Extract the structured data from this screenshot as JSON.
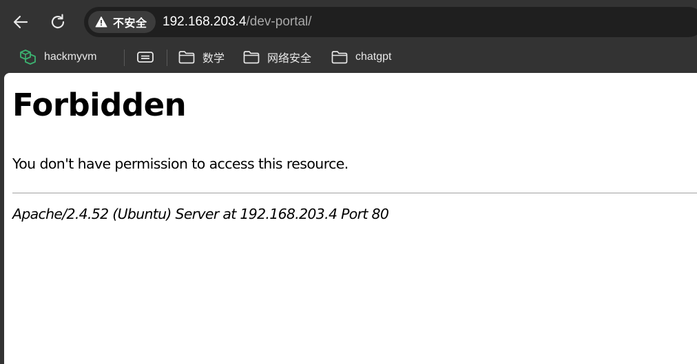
{
  "browser": {
    "security_label": "不安全",
    "url_host": "192.168.203.4",
    "url_path": "/dev-portal/",
    "nav": {
      "back_icon": "arrow-left-icon",
      "reload_icon": "reload-icon",
      "security_icon": "warning-triangle-icon"
    },
    "bookmarks": [
      {
        "label": "hackmyvm",
        "icon": "hackmyvm-cube-icon"
      },
      {
        "label": "",
        "icon": "reading-list-icon"
      },
      {
        "label": "数学",
        "icon": "folder-icon"
      },
      {
        "label": "网络安全",
        "icon": "folder-icon"
      },
      {
        "label": "chatgpt",
        "icon": "folder-icon"
      }
    ],
    "colors": {
      "chrome_bg": "#333333",
      "omnibox_bg": "#1f1f1f",
      "url_path": "#a8a8a8",
      "hackmyvm_icon": "#3cb371"
    }
  },
  "page": {
    "title": "Forbidden",
    "message": "You don't have permission to access this resource.",
    "server_signature": "Apache/2.4.52 (Ubuntu) Server at 192.168.203.4 Port 80"
  }
}
